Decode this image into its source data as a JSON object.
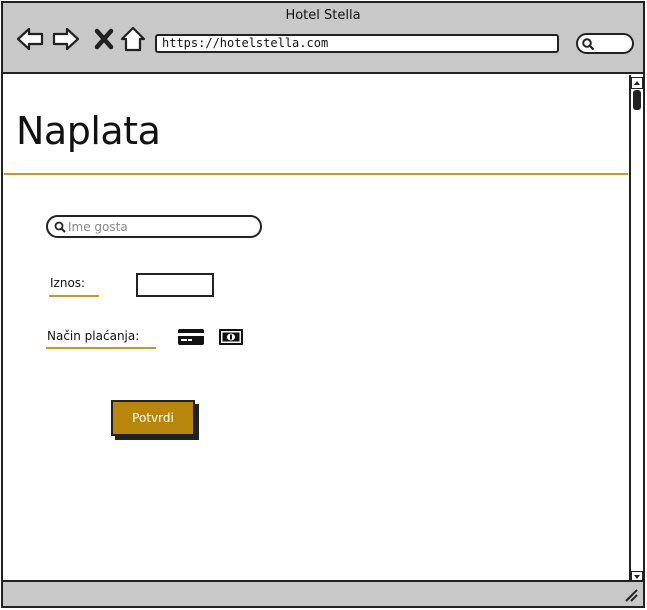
{
  "window": {
    "title": "Hotel Stella",
    "address": "https://hotelstella.com"
  },
  "toolbar": {
    "icons": [
      "back-arrow-icon",
      "forward-arrow-icon",
      "close-icon",
      "home-icon",
      "search-icon"
    ]
  },
  "page": {
    "title": "Naplata"
  },
  "form": {
    "guest_search_placeholder": "Ime gosta",
    "amount_label": "Iznos:",
    "amount_value": "",
    "payment_label": "Način plaćanja:",
    "payment_methods": [
      "credit-card-icon",
      "cash-icon"
    ],
    "confirm_label": "Potvrdi"
  },
  "colors": {
    "accent": "#c79a1e",
    "button": "#b8860b",
    "chrome": "#c8c8c8"
  }
}
